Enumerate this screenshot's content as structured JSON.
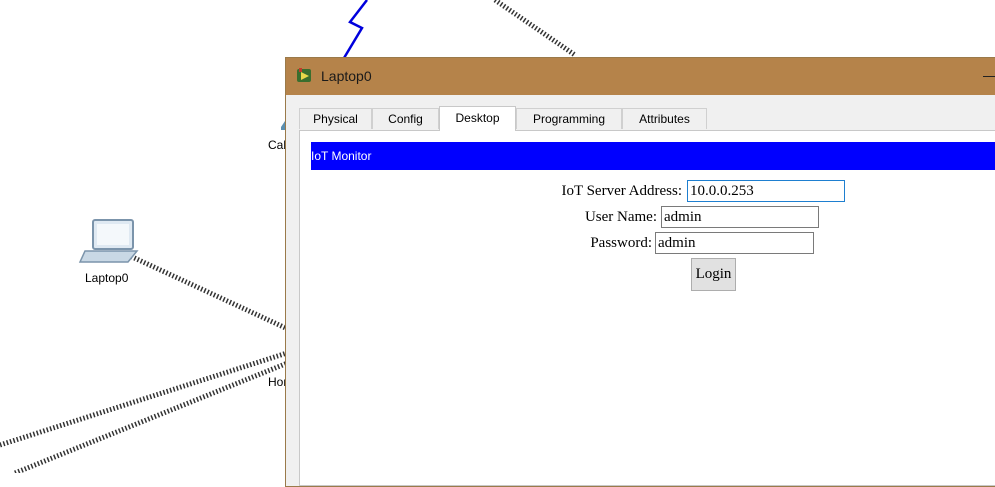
{
  "workspace": {
    "devices": [
      {
        "label": "Laptop0",
        "icon": "laptop-icon"
      },
      {
        "label": "Cab",
        "icon": "cable-modem-icon"
      },
      {
        "label": "Hor",
        "icon": "home-gateway-icon"
      }
    ]
  },
  "window": {
    "title": "Laptop0",
    "title_icon": "packet-tracer-icon",
    "tabs": [
      {
        "label": "Physical",
        "active": false
      },
      {
        "label": "Config",
        "active": false
      },
      {
        "label": "Desktop",
        "active": true
      },
      {
        "label": "Programming",
        "active": false
      },
      {
        "label": "Attributes",
        "active": false
      }
    ]
  },
  "iot_monitor": {
    "header": "IoT Monitor",
    "header_color": "#0000ff",
    "server_address_label": "IoT Server Address:",
    "server_address_value": "10.0.0.253",
    "username_label": "User Name:",
    "username_value": "admin",
    "password_label": "Password:",
    "password_value": "admin",
    "login_label": "Login"
  },
  "colors": {
    "titlebar": "#b5834a",
    "wireless_link": "#0000dd",
    "cable_link": "#222222"
  }
}
